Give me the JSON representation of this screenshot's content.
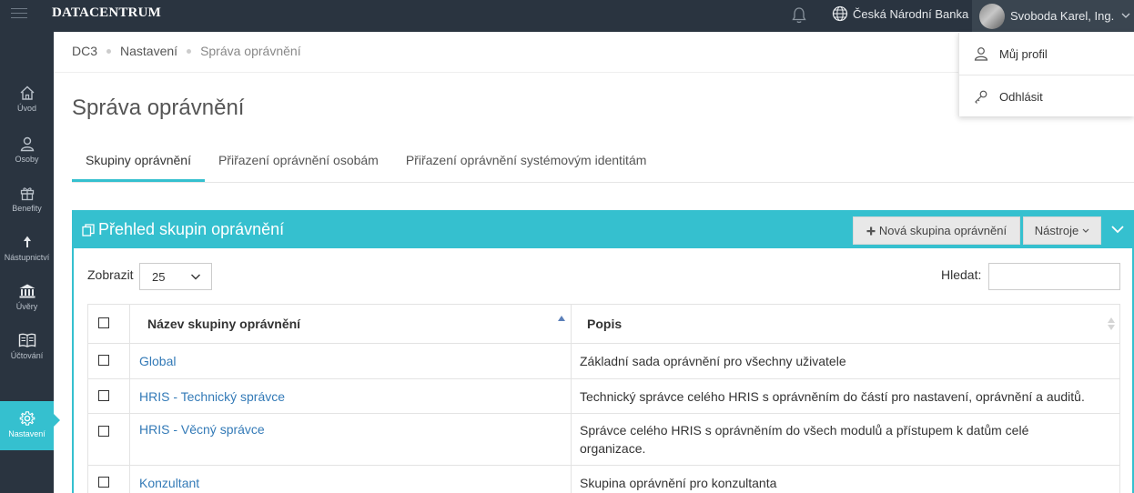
{
  "topbar": {
    "logo": "DATACENTRUM",
    "organization": "Česká Národní Banka",
    "user_name": "Svoboda Karel, Ing."
  },
  "sidebar": {
    "items": [
      {
        "label": "Úvod",
        "icon": "home-icon"
      },
      {
        "label": "Osoby",
        "icon": "person-icon"
      },
      {
        "label": "Benefity",
        "icon": "gift-icon"
      },
      {
        "label": "Nástupnictví",
        "icon": "arrow-up-icon"
      },
      {
        "label": "Úvěry",
        "icon": "bank-icon"
      },
      {
        "label": "Účtování",
        "icon": "book-icon"
      },
      {
        "label": "Nastavení",
        "icon": "gear-icon",
        "active": true
      }
    ]
  },
  "breadcrumb": [
    "DC3",
    "Nastavení",
    "Správa oprávnění"
  ],
  "page_title": "Správa oprávnění",
  "tabs": [
    {
      "label": "Skupiny oprávnění",
      "active": true
    },
    {
      "label": "Přiřazení oprávnění osobám"
    },
    {
      "label": "Přiřazení oprávnění systémovým identitám"
    }
  ],
  "panel": {
    "title": "Přehled skupin oprávnění",
    "new_button": "Nová skupina oprávnění",
    "tools_button": "Nástroje",
    "show_label": "Zobrazit",
    "page_size": "25",
    "search_label": "Hledat:",
    "search_value": ""
  },
  "table": {
    "columns": [
      "Název skupiny oprávnění",
      "Popis"
    ],
    "rows": [
      {
        "name": "Global",
        "description": "Základní sada oprávnění pro všechny uživatele"
      },
      {
        "name": "HRIS - Technický správce",
        "description": "Technický správce celého HRIS s oprávněním do částí pro nastavení, oprávnění a auditů."
      },
      {
        "name": "HRIS - Věcný správce",
        "description": "Správce celého HRIS s oprávněním do všech modulů a přístupem k datům celé organizace."
      },
      {
        "name": "Konzultant",
        "description": "Skupina oprávnění pro konzultanta"
      }
    ]
  },
  "user_menu": {
    "items": [
      {
        "label": "Můj profil",
        "icon": "user-icon"
      },
      {
        "label": "Odhlásit",
        "icon": "key-icon"
      }
    ]
  },
  "colors": {
    "accent": "#35c0cf",
    "sidebar": "#2a3440",
    "link": "#337ab7"
  }
}
